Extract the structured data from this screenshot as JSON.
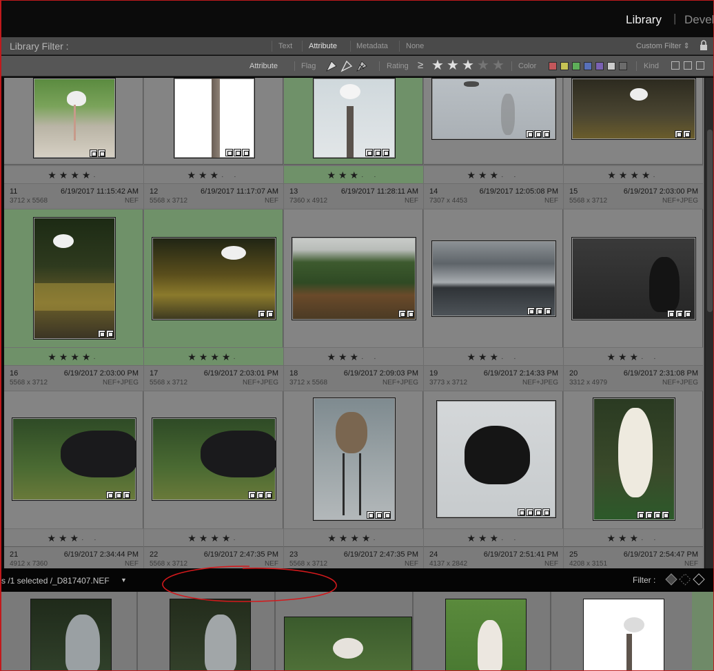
{
  "modules": {
    "library": "Library",
    "separator": "|",
    "develop": "Devel"
  },
  "filter_bar": {
    "title": "Library Filter :",
    "tabs": [
      "Text",
      "Attribute",
      "Metadata",
      "None"
    ],
    "active_tab": "Attribute",
    "custom_filter": "Custom Filter ⇕"
  },
  "attribute_bar": {
    "title": "Attribute",
    "flag_label": "Flag",
    "rating_label": "Rating",
    "rating_operator": "≥",
    "rating_value": 3,
    "color_label": "Color",
    "kind_label": "Kind",
    "colors": [
      "#c4575b",
      "#c7c354",
      "#5eae59",
      "#5870b9",
      "#7b62b3",
      "#cccccc",
      "#6b6b6b"
    ]
  },
  "grid": {
    "row1": [
      {
        "stars": "★★★★",
        "dots": "·"
      },
      {
        "stars": "★★★",
        "dots": "· ·"
      },
      {
        "stars": "★★★",
        "dots": "· ·"
      },
      {
        "stars": "★★★",
        "dots": "· ·"
      },
      {
        "stars": "★★★★",
        "dots": "·"
      }
    ],
    "cells": [
      {
        "num": "11",
        "date": "6/19/2017 11:15:42 AM",
        "dim": "3712 x 5568",
        "ext": "NEF",
        "stars": "★★★★",
        "dots": "·",
        "selected": true
      },
      {
        "num": "12",
        "date": "6/19/2017 11:17:07 AM",
        "dim": "5568 x 3712",
        "ext": "NEF",
        "stars": "★★★★",
        "dots": "·",
        "selected": true
      },
      {
        "num": "13",
        "date": "6/19/2017 11:28:11 AM",
        "dim": "7360 x 4912",
        "ext": "NEF",
        "stars": "★★★",
        "dots": "· ·",
        "selected": false
      },
      {
        "num": "14",
        "date": "6/19/2017 12:05:08 PM",
        "dim": "7307 x 4453",
        "ext": "NEF",
        "stars": "★★★",
        "dots": "· ·",
        "selected": false
      },
      {
        "num": "15",
        "date": "6/19/2017 2:03:00 PM",
        "dim": "5568 x 3712",
        "ext": "NEF+JPEG",
        "stars": "★★★",
        "dots": "· ·",
        "selected": false
      },
      {
        "num": "16",
        "date": "6/19/2017 2:03:00 PM",
        "dim": "5568 x 3712",
        "ext": "NEF+JPEG",
        "stars": "★★★",
        "dots": "· ·",
        "selected": false
      },
      {
        "num": "17",
        "date": "6/19/2017 2:03:01 PM",
        "dim": "5568 x 3712",
        "ext": "NEF+JPEG",
        "stars": "★★★★",
        "dots": "·",
        "selected": false
      },
      {
        "num": "18",
        "date": "6/19/2017 2:09:03 PM",
        "dim": "3712 x 5568",
        "ext": "NEF+JPEG",
        "stars": "★★★★",
        "dots": "·",
        "selected": false
      },
      {
        "num": "19",
        "date": "6/19/2017 2:14:33 PM",
        "dim": "3773 x 3712",
        "ext": "NEF+JPEG",
        "stars": "★★★",
        "dots": "· ·",
        "selected": false
      },
      {
        "num": "20",
        "date": "6/19/2017 2:31:08 PM",
        "dim": "3312 x 4979",
        "ext": "NEF+JPEG",
        "stars": "★★★",
        "dots": "· ·",
        "selected": false
      },
      {
        "num": "21",
        "date": "6/19/2017 2:34:44 PM",
        "dim": "4912 x 7360",
        "ext": "NEF"
      },
      {
        "num": "22",
        "date": "6/19/2017 2:47:35 PM",
        "dim": "5568 x 3712",
        "ext": "NEF"
      },
      {
        "num": "23",
        "date": "6/19/2017 2:47:35 PM",
        "dim": "5568 x 3712",
        "ext": "NEF"
      },
      {
        "num": "24",
        "date": "6/19/2017 2:51:41 PM",
        "dim": "4137 x 2842",
        "ext": "NEF"
      },
      {
        "num": "25",
        "date": "6/19/2017 2:54:47 PM",
        "dim": "4208 x 3151",
        "ext": "NEF"
      }
    ]
  },
  "filmstrip": {
    "status": "s /1 selected /_D817407.NEF",
    "dropdown_arrow": "▼",
    "filter_label": "Filter :"
  }
}
